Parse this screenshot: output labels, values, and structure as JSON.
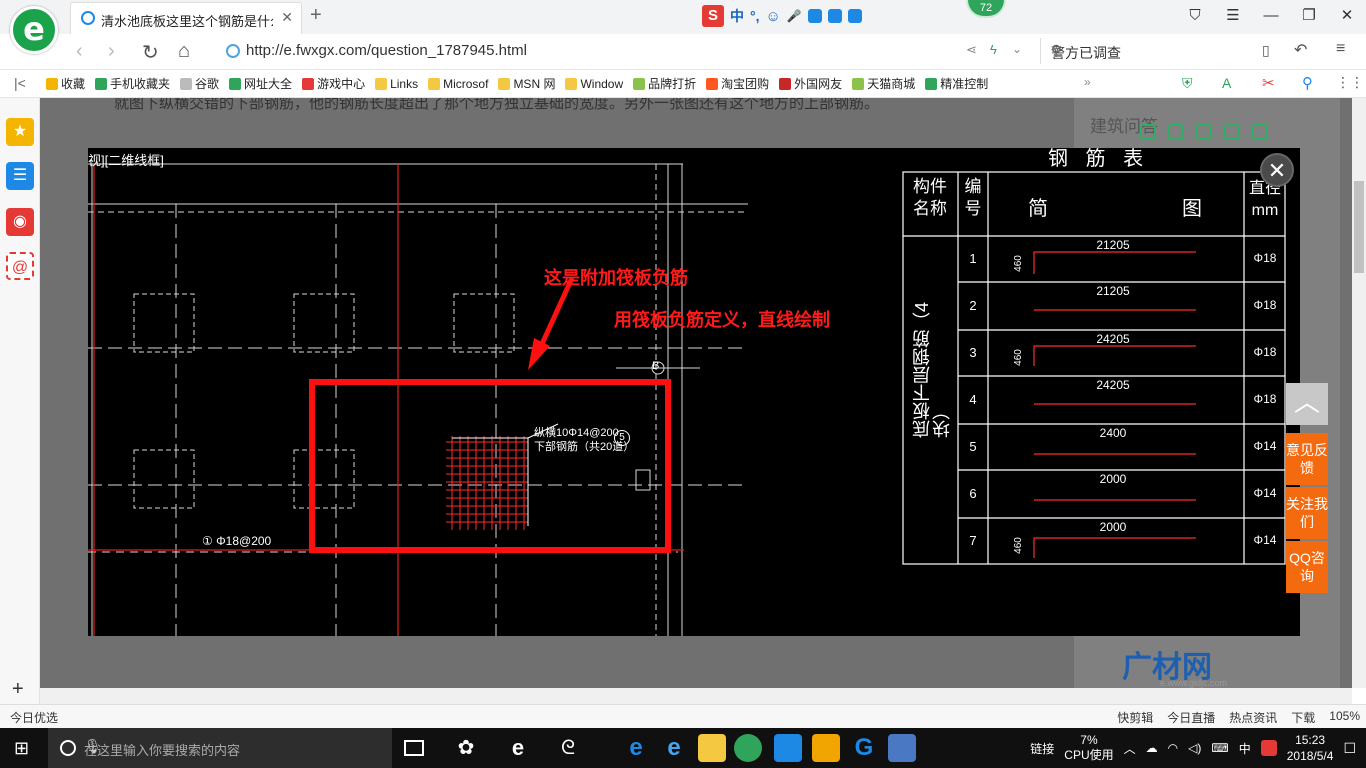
{
  "browser": {
    "tab_title": "清水池底板这里这个钢筋是什么意思",
    "url": "http://e.fwxgx.com/question_1787945.html",
    "search_box": "警方已调查",
    "badge_count": "72",
    "ime_label": "中",
    "ime_punct": "°,"
  },
  "bookmarks": [
    {
      "label": "收藏",
      "color": "#f5b400"
    },
    {
      "label": "手机收藏夹",
      "color": "#2ea55a"
    },
    {
      "label": "谷歌",
      "color": "#bbb"
    },
    {
      "label": "网址大全",
      "color": "#2ea55a"
    },
    {
      "label": "游戏中心",
      "color": "#e53935"
    },
    {
      "label": "Links",
      "color": "#f5c842"
    },
    {
      "label": "Microsof",
      "color": "#f5c842"
    },
    {
      "label": "MSN 网",
      "color": "#f5c842"
    },
    {
      "label": "Window",
      "color": "#f5c842"
    },
    {
      "label": "品牌打折",
      "color": "#8bc34a"
    },
    {
      "label": "淘宝团购",
      "color": "#ff5722"
    },
    {
      "label": "外国网友",
      "color": "#c62828"
    },
    {
      "label": "天猫商城",
      "color": "#8bc34a"
    },
    {
      "label": "精准控制",
      "color": "#2ea55a"
    }
  ],
  "page": {
    "bg_text": "就图下纵横交错的下部钢筋，他的钢筋长度超出了那个地方独立基础的宽度。另外一张图还有这个地方的上部钢筋。",
    "bg_title": "建筑问答",
    "float_buttons": [
      "意见反馈",
      "关注我们",
      "QQ咨询"
    ],
    "brand": "广材网",
    "brand_sub": "e.www.gldjc.com"
  },
  "cad": {
    "view_label": "视][二维线框]",
    "annotation_1": "这是附加筏板负筋",
    "annotation_2": "用筏板负筋定义，直线绘制",
    "rebar_label_1": "纵横10Φ14@200",
    "rebar_label_2": "下部钢筋（共20道）",
    "rebar_circle": "5",
    "bottom_label": "① Φ18@200",
    "grid_label": "B",
    "table_title": "钢 筋 表",
    "table_headers": [
      "构件名称",
      "编号",
      "简",
      "图",
      "直径mm"
    ],
    "table_group": "底板下层钢筋（4块）",
    "table_rows": [
      {
        "no": "1",
        "len": "21205",
        "hook": "460",
        "dia": "Φ18"
      },
      {
        "no": "2",
        "len": "21205",
        "hook": "",
        "dia": "Φ18"
      },
      {
        "no": "3",
        "len": "24205",
        "hook": "460",
        "dia": "Φ18"
      },
      {
        "no": "4",
        "len": "24205",
        "hook": "",
        "dia": "Φ18"
      },
      {
        "no": "5",
        "len": "2400",
        "hook": "",
        "dia": "Φ14"
      },
      {
        "no": "6",
        "len": "2000",
        "hook": "",
        "dia": "Φ14"
      },
      {
        "no": "7",
        "len": "2000",
        "hook": "460",
        "dia": "Φ14"
      }
    ]
  },
  "statusbar": {
    "left": "今日优选",
    "items": [
      "快剪辑",
      "今日直播",
      "热点资讯",
      "下载",
      "105%"
    ]
  },
  "taskbar": {
    "search_placeholder": "在这里输入你要搜索的内容",
    "link_label": "链接",
    "cpu_percent": "7%",
    "cpu_label": "CPU使用",
    "ime": "中",
    "time": "15:23",
    "date": "2018/5/4"
  }
}
